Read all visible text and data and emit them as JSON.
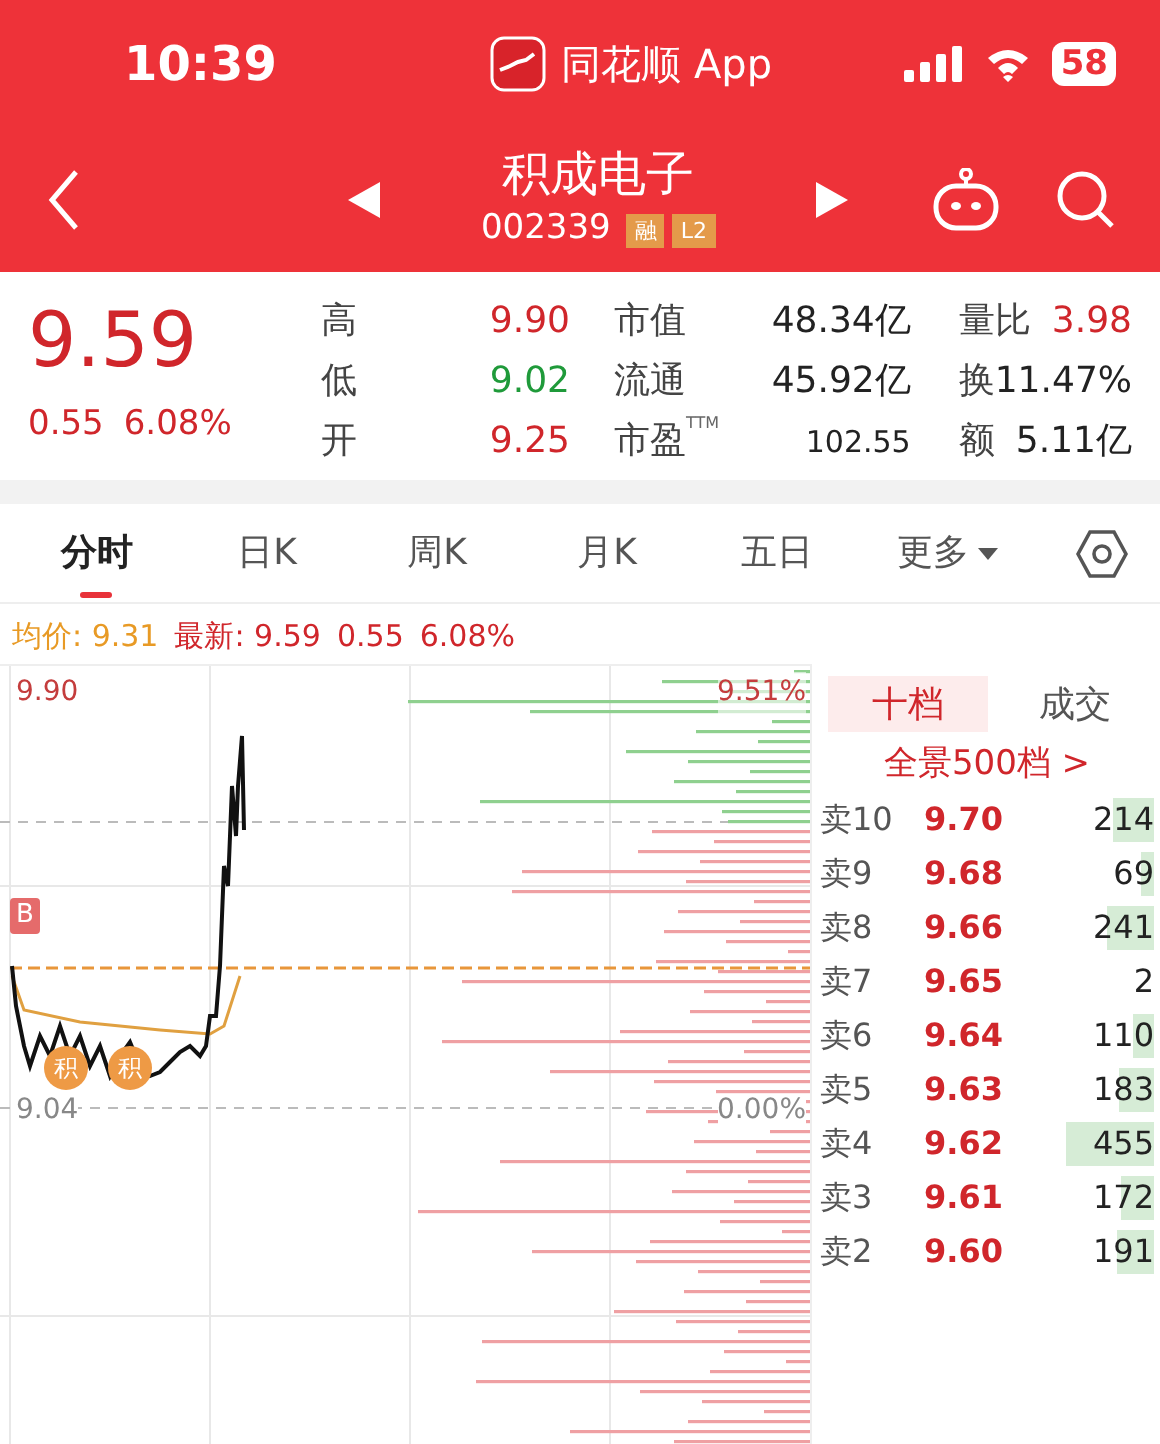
{
  "status_bar": {
    "time": "10:39",
    "app_name": "同花顺 App",
    "battery": "58"
  },
  "header": {
    "stock_name": "积成电子",
    "code": "002339",
    "badges": [
      "融",
      "L2"
    ]
  },
  "quote": {
    "price": "9.59",
    "change": "0.55",
    "change_pct": "6.08%",
    "stats": [
      {
        "label": "高",
        "value": "9.90",
        "color": "#d0262b"
      },
      {
        "label": "低",
        "value": "9.02",
        "color": "#1f9a3a"
      },
      {
        "label": "开",
        "value": "9.25",
        "color": "#d0262b"
      }
    ],
    "metrics": [
      {
        "label": "市值",
        "value": "48.34亿"
      },
      {
        "label": "流通",
        "value": "45.92亿"
      },
      {
        "label": "市盈",
        "sup": "TTM",
        "value": "102.55"
      }
    ],
    "extra": [
      {
        "label": "量比",
        "value": "3.98",
        "color": "#d0262b"
      },
      {
        "label": "换",
        "value": "11.47%",
        "color": "#222222"
      },
      {
        "label": "额",
        "value": "5.11亿",
        "color": "#222222"
      }
    ]
  },
  "tabs": [
    {
      "label": "分时",
      "selected": true
    },
    {
      "label": "日K",
      "selected": false
    },
    {
      "label": "周K",
      "selected": false
    },
    {
      "label": "月K",
      "selected": false
    },
    {
      "label": "五日",
      "selected": false
    },
    {
      "label": "更多",
      "selected": false
    }
  ],
  "info_line": {
    "avg_label": "均价: 9.31",
    "latest_label": "最新: 9.59",
    "change": "0.55",
    "change_pct": "6.08%"
  },
  "chart": {
    "high": "9.90",
    "high_pct": "9.51%",
    "low": "9.04",
    "low_pct": "0.00%",
    "buy_marker": "B",
    "markers": [
      "积",
      "积"
    ]
  },
  "order_book": {
    "tabs": [
      {
        "label": "十档",
        "selected": true
      },
      {
        "label": "成交",
        "selected": false
      }
    ],
    "link": "全景500档 >",
    "rows": [
      {
        "label": "卖10",
        "price": "9.70",
        "volume": "214"
      },
      {
        "label": "卖9",
        "price": "9.68",
        "volume": "69"
      },
      {
        "label": "卖8",
        "price": "9.66",
        "volume": "241"
      },
      {
        "label": "卖7",
        "price": "9.65",
        "volume": "2"
      },
      {
        "label": "卖6",
        "price": "9.64",
        "volume": "110"
      },
      {
        "label": "卖5",
        "price": "9.63",
        "volume": "183"
      },
      {
        "label": "卖4",
        "price": "9.62",
        "volume": "455"
      },
      {
        "label": "卖3",
        "price": "9.61",
        "volume": "172"
      },
      {
        "label": "卖2",
        "price": "9.60",
        "volume": "191"
      }
    ]
  }
}
